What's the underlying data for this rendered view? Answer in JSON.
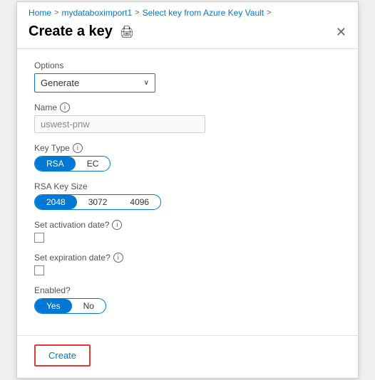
{
  "breadcrumb": {
    "home": "Home",
    "sep1": ">",
    "resource": "mydataboximport1",
    "sep2": ">",
    "page": "Select key from Azure Key Vault",
    "sep3": ">"
  },
  "header": {
    "title": "Create a key",
    "print_icon": "🖨",
    "close_icon": "✕"
  },
  "form": {
    "options_label": "Options",
    "options_value": "Generate",
    "options_chevron": "∨",
    "name_label": "Name",
    "name_placeholder": "uswest-pnw",
    "key_type_label": "Key Type",
    "key_type_options": [
      "RSA",
      "EC"
    ],
    "key_type_active": "RSA",
    "rsa_key_size_label": "RSA Key Size",
    "rsa_key_size_options": [
      "2048",
      "3072",
      "4096"
    ],
    "rsa_key_size_active": "2048",
    "activation_label": "Set activation date?",
    "expiration_label": "Set expiration date?",
    "enabled_label": "Enabled?",
    "enabled_options": [
      "Yes",
      "No"
    ],
    "enabled_active": "Yes"
  },
  "footer": {
    "create_label": "Create"
  }
}
